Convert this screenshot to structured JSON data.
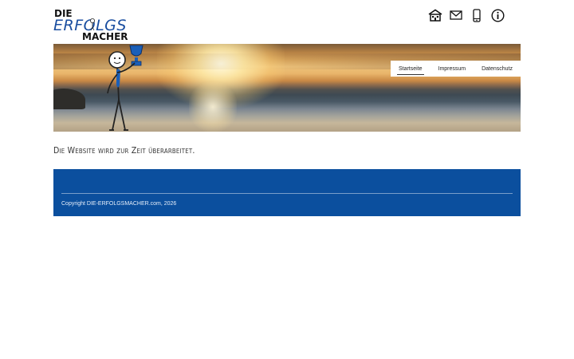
{
  "logo": {
    "line1": "DIE",
    "line2": "ERFOLGS",
    "line3": "MACHER"
  },
  "top_icons": [
    {
      "name": "home-icon"
    },
    {
      "name": "mail-icon"
    },
    {
      "name": "phone-icon"
    },
    {
      "name": "info-icon"
    }
  ],
  "nav": {
    "items": [
      {
        "label": "Startseite",
        "active": true
      },
      {
        "label": "Impressum",
        "active": false
      },
      {
        "label": "Datenschutz",
        "active": false
      }
    ]
  },
  "main": {
    "notice": "Die Website wird zur Zeit überarbeitet."
  },
  "footer": {
    "copyright": "Copyright DIE-ERFOLGSMACHER.com, 2026"
  },
  "colors": {
    "brand_blue": "#0b4f9e",
    "logo_blue": "#1a4ea0"
  }
}
